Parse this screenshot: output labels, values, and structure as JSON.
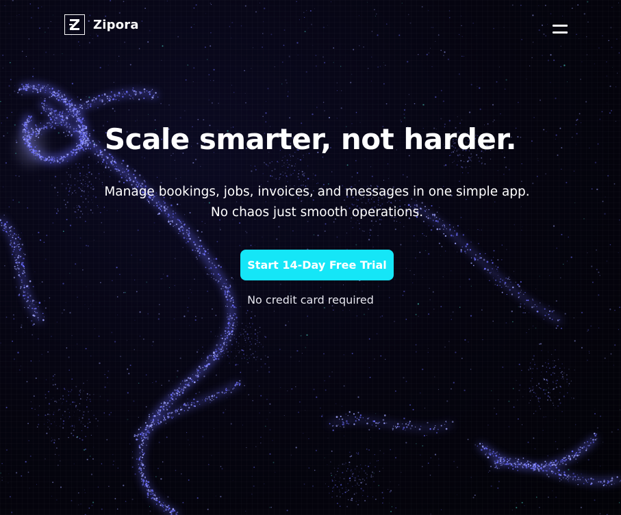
{
  "brand": {
    "name": "Zipora",
    "logo_letter": "Z",
    "logo_icon": "z-logo-icon"
  },
  "header": {
    "menu_icon": "hamburger-menu-icon"
  },
  "hero": {
    "title": "Scale smarter, not harder.",
    "subtitle": "Manage bookings, jobs, invoices, and messages in one simple app. No chaos just smooth operations.",
    "cta_label": "Start 14-Day Free Trial",
    "note": "No credit card required"
  },
  "colors": {
    "background": "#04030c",
    "accent": "#15e6f7",
    "particles_primary": "#6a6cff",
    "particles_secondary": "#9fa4ff",
    "particles_highlight": "#4fe0d0",
    "text": "#ffffff"
  }
}
